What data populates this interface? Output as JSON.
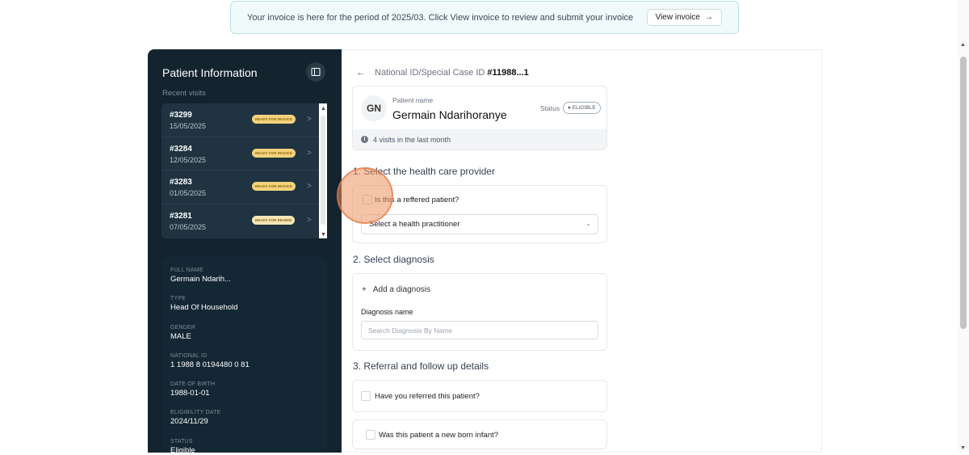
{
  "banner": {
    "text": "Your invoice is here for the period of 2025/03. Click View invoice to review and submit your invoice",
    "button_label": "View invoice",
    "button_icon": "arrow-right-icon"
  },
  "sidebar": {
    "title": "Patient Information",
    "toggle_icon": "sidebar-toggle-icon",
    "recent_label": "Recent visits",
    "visits": [
      {
        "id": "#3299",
        "date": "15/05/2025",
        "status": "READY FOR INVOICE"
      },
      {
        "id": "#3284",
        "date": "12/05/2025",
        "status": "READY FOR INVOICE"
      },
      {
        "id": "#3283",
        "date": "01/05/2025",
        "status": "READY FOR INVOICE"
      },
      {
        "id": "#3281",
        "date": "07/05/2025",
        "status": "READY FOR REVIEW"
      }
    ],
    "details": [
      {
        "label": "Full name",
        "value": "Germain Ndarih..."
      },
      {
        "label": "Type",
        "value": "Head Of Household"
      },
      {
        "label": "Gender",
        "value": "MALE"
      },
      {
        "label": "National ID",
        "value": "1 1988 8 0194480 0 81"
      },
      {
        "label": "Date of birth",
        "value": "1988-01-01"
      },
      {
        "label": "Eligibility date",
        "value": "2024/11/29"
      },
      {
        "label": "Status",
        "value": "Eligible"
      }
    ]
  },
  "main": {
    "breadcrumb_prefix": "National ID/Special Case ID",
    "breadcrumb_id": "#11988...1",
    "patient": {
      "initials": "GN",
      "name_label": "Patient name",
      "name": "Germain Ndarihoranye",
      "status_label": "Status",
      "status": "ELIGIBLE",
      "visits_note": "4 visits in the last month"
    },
    "sections": {
      "provider": {
        "title": "1. Select the health care provider",
        "referred_label": "Is this a reffered patient?",
        "practitioner_placeholder": "Select a health practitioner"
      },
      "diagnosis": {
        "title": "2. Select diagnosis",
        "add_label": "Add a diagnosis",
        "name_label": "Diagnosis name",
        "search_placeholder": "Search Diagnosis By Name"
      },
      "referral": {
        "title": "3. Referral and follow up details",
        "referred_label": "Have you referred this patient?",
        "infant_label": "Was this patient a new born infant?"
      }
    }
  }
}
